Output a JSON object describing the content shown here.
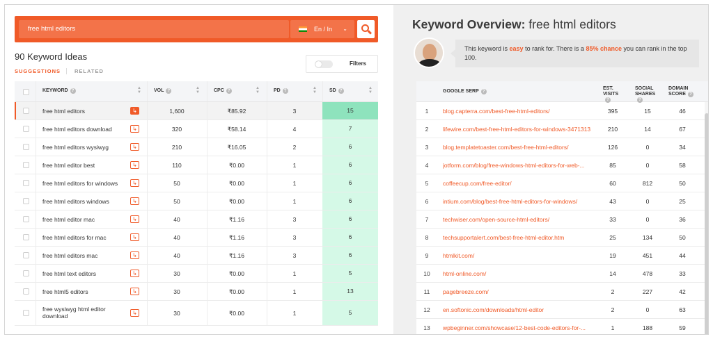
{
  "search": {
    "query": "free html editors",
    "locale": "En / In"
  },
  "ideas": {
    "title": "90 Keyword Ideas",
    "tab_suggestions": "SUGGESTIONS",
    "tab_related": "RELATED",
    "filters": "Filters"
  },
  "table": {
    "headers": {
      "keyword": "KEYWORD",
      "vol": "VOL",
      "cpc": "CPC",
      "pd": "PD",
      "sd": "SD"
    },
    "rows": [
      {
        "keyword": "free html editors",
        "vol": "1,600",
        "cpc": "₹85.92",
        "pd": "3",
        "sd": "15"
      },
      {
        "keyword": "free html editors download",
        "vol": "320",
        "cpc": "₹58.14",
        "pd": "4",
        "sd": "7"
      },
      {
        "keyword": "free html editors wysiwyg",
        "vol": "210",
        "cpc": "₹16.05",
        "pd": "2",
        "sd": "6"
      },
      {
        "keyword": "free html editor best",
        "vol": "110",
        "cpc": "₹0.00",
        "pd": "1",
        "sd": "6"
      },
      {
        "keyword": "free html editors for windows",
        "vol": "50",
        "cpc": "₹0.00",
        "pd": "1",
        "sd": "6"
      },
      {
        "keyword": "free html editors windows",
        "vol": "50",
        "cpc": "₹0.00",
        "pd": "1",
        "sd": "6"
      },
      {
        "keyword": "free html editor mac",
        "vol": "40",
        "cpc": "₹1.16",
        "pd": "3",
        "sd": "6"
      },
      {
        "keyword": "free html editors for mac",
        "vol": "40",
        "cpc": "₹1.16",
        "pd": "3",
        "sd": "6"
      },
      {
        "keyword": "free html editors mac",
        "vol": "40",
        "cpc": "₹1.16",
        "pd": "3",
        "sd": "6"
      },
      {
        "keyword": "free html text editors",
        "vol": "30",
        "cpc": "₹0.00",
        "pd": "1",
        "sd": "5"
      },
      {
        "keyword": "free html5 editors",
        "vol": "30",
        "cpc": "₹0.00",
        "pd": "1",
        "sd": "13"
      },
      {
        "keyword": "free wysiwyg html editor download",
        "vol": "30",
        "cpc": "₹0.00",
        "pd": "1",
        "sd": "5"
      }
    ]
  },
  "overview": {
    "title_prefix": "Keyword Overview:",
    "title_keyword": "free html editors",
    "msg_a": "This keyword is ",
    "msg_easy": "easy",
    "msg_b": " to rank for. There is a ",
    "msg_chance": "85% chance",
    "msg_c": " you can rank in the top 100."
  },
  "serp": {
    "headers": {
      "serp": "GOOGLE SERP",
      "visits": "EST. VISITS",
      "shares": "SOCIAL SHARES",
      "domain": "DOMAIN SCORE"
    },
    "rows": [
      {
        "idx": "1",
        "url": "blog.capterra.com/best-free-html-editors/",
        "visits": "395",
        "shares": "15",
        "domain": "46"
      },
      {
        "idx": "2",
        "url": "lifewire.com/best-free-html-editors-for-windows-3471313",
        "visits": "210",
        "shares": "14",
        "domain": "67"
      },
      {
        "idx": "3",
        "url": "blog.templatetoaster.com/best-free-html-editors/",
        "visits": "126",
        "shares": "0",
        "domain": "34"
      },
      {
        "idx": "4",
        "url": "jotform.com/blog/free-windows-html-editors-for-web-...",
        "visits": "85",
        "shares": "0",
        "domain": "58"
      },
      {
        "idx": "5",
        "url": "coffeecup.com/free-editor/",
        "visits": "60",
        "shares": "812",
        "domain": "50"
      },
      {
        "idx": "6",
        "url": "intium.com/blog/best-free-html-editors-for-windows/",
        "visits": "43",
        "shares": "0",
        "domain": "25"
      },
      {
        "idx": "7",
        "url": "techwiser.com/open-source-html-editors/",
        "visits": "33",
        "shares": "0",
        "domain": "36"
      },
      {
        "idx": "8",
        "url": "techsupportalert.com/best-free-html-editor.htm",
        "visits": "25",
        "shares": "134",
        "domain": "50"
      },
      {
        "idx": "9",
        "url": "htmlkit.com/",
        "visits": "19",
        "shares": "451",
        "domain": "44"
      },
      {
        "idx": "10",
        "url": "html-online.com/",
        "visits": "14",
        "shares": "478",
        "domain": "33"
      },
      {
        "idx": "11",
        "url": "pagebreeze.com/",
        "visits": "2",
        "shares": "227",
        "domain": "42"
      },
      {
        "idx": "12",
        "url": "en.softonic.com/downloads/html-editor",
        "visits": "2",
        "shares": "0",
        "domain": "63"
      },
      {
        "idx": "13",
        "url": "wpbeginner.com/showcase/12-best-code-editors-for-...",
        "visits": "1",
        "shares": "188",
        "domain": "59"
      }
    ]
  },
  "icons": {
    "search": "search-icon",
    "help": "question-circle-icon",
    "sort": "sort-icon",
    "jump": "arrow-jump-icon",
    "flag": "india-flag-icon",
    "chevron": "chevron-down-icon"
  },
  "colors": {
    "accent": "#f05a28",
    "sd_easy": "#d5f9e7",
    "sd_active": "#8ee3bd"
  }
}
